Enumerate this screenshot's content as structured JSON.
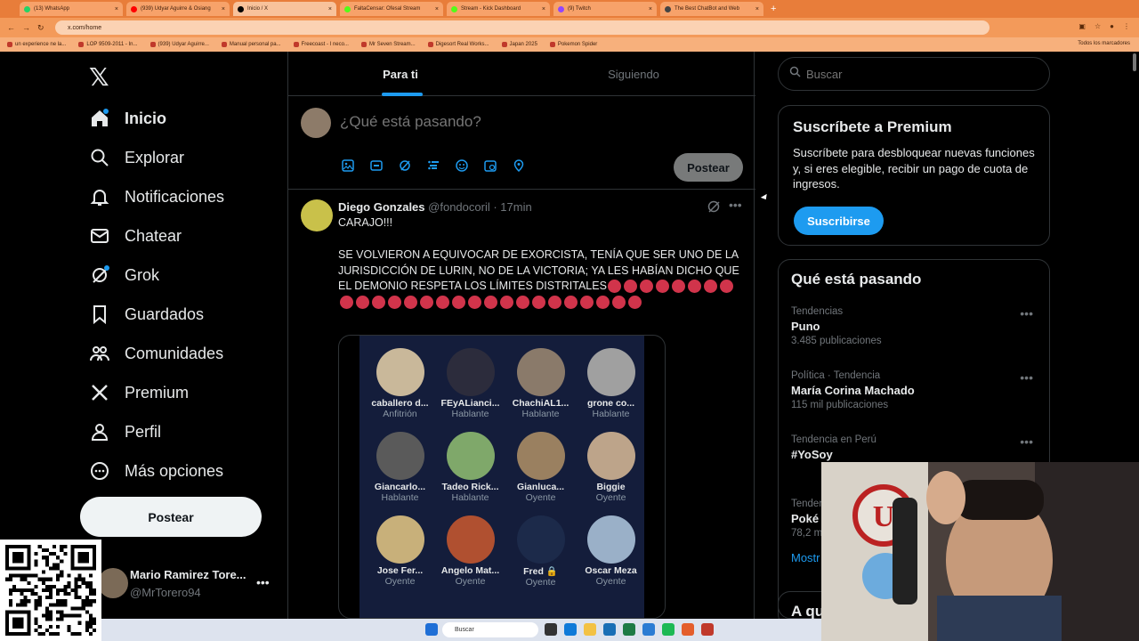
{
  "browser": {
    "tabs": [
      {
        "label": "(13) WhatsApp",
        "color": "#25d366"
      },
      {
        "label": "(939) Udyar Aguirre & Osiang",
        "color": "#ff0000"
      },
      {
        "label": "Inicio / X",
        "color": "#000000"
      },
      {
        "label": "FaltaCensar: Ofesal Stream",
        "color": "#53fc18"
      },
      {
        "label": "Stream - Kick Dashboard",
        "color": "#53fc18"
      },
      {
        "label": "(9) Twitch",
        "color": "#9146ff"
      },
      {
        "label": "The Best ChatBot and Web",
        "color": "#444444"
      }
    ],
    "url": "x.com/home",
    "bookmarks": [
      "un experience ne la...",
      "LOP 9509-2011 - In...",
      "(939) Udyar Aguirre...",
      "Manual personal pa...",
      "Freecoast - I neco...",
      "Mr Seven Stream...",
      "Digesort Real Works...",
      "Japan 2025",
      "Pokemon Spider"
    ],
    "bookmarks_right": "Todos los marcadores"
  },
  "sidebar": {
    "logo": "X",
    "items": [
      {
        "label": "Inicio",
        "icon": "home-icon"
      },
      {
        "label": "Explorar",
        "icon": "search-icon"
      },
      {
        "label": "Notificaciones",
        "icon": "bell-icon"
      },
      {
        "label": "Chatear",
        "icon": "mail-icon"
      },
      {
        "label": "Grok",
        "icon": "grok-icon"
      },
      {
        "label": "Guardados",
        "icon": "bookmark-icon"
      },
      {
        "label": "Comunidades",
        "icon": "communities-icon"
      },
      {
        "label": "Premium",
        "icon": "x-icon"
      },
      {
        "label": "Perfil",
        "icon": "person-icon"
      },
      {
        "label": "Más opciones",
        "icon": "more-circle-icon"
      }
    ],
    "post_label": "Postear",
    "profile": {
      "name": "Mario Ramirez Tore...",
      "handle": "@MrTorero94"
    }
  },
  "main": {
    "tabs": [
      {
        "label": "Para ti"
      },
      {
        "label": "Siguiendo"
      }
    ],
    "compose": {
      "placeholder": "¿Qué está pasando?",
      "post_label": "Postear"
    },
    "tweet": {
      "name": "Diego Gonzales",
      "handle": "@fondocoril",
      "time": "· 17min",
      "line1": "CARAJO!!!",
      "body": "SE VOLVIERON A EQUIVOCAR DE EXORCISTA, TENÍA QUE SER UNO DE LA JURISDICCIÓN DE LURIN, NO DE LA VICTORIA; YA LES HABÍAN DICHO QUE EL DEMONIO RESPETA LOS LÍMITES DISTRITALES",
      "space_participants": [
        {
          "name": "caballero d...",
          "role": "Anfitrión"
        },
        {
          "name": "FEyALianci...",
          "role": "Hablante"
        },
        {
          "name": "ChachiAL1...",
          "role": "Hablante"
        },
        {
          "name": "grone co...",
          "role": "Hablante"
        },
        {
          "name": "Giancarlo...",
          "role": "Hablante"
        },
        {
          "name": "Tadeo Rick...",
          "role": "Hablante"
        },
        {
          "name": "Gianluca...",
          "role": "Oyente"
        },
        {
          "name": "Biggie",
          "role": "Oyente"
        },
        {
          "name": "Jose Fer...",
          "role": "Oyente"
        },
        {
          "name": "Angelo Mat...",
          "role": "Oyente"
        },
        {
          "name": "Fred 🔒",
          "role": "Oyente"
        },
        {
          "name": "Oscar Meza",
          "role": "Oyente"
        }
      ]
    }
  },
  "right": {
    "search_placeholder": "Buscar",
    "premium": {
      "title": "Suscríbete a Premium",
      "text": "Suscríbete para desbloquear nuevas funciones y, si eres elegible, recibir un pago de cuota de ingresos.",
      "button": "Suscribirse"
    },
    "trends_title": "Qué está pasando",
    "trends": [
      {
        "meta": "Tendencias",
        "title": "Puno",
        "count": "3.485 publicaciones"
      },
      {
        "meta": "Política · Tendencia",
        "title": "María Corina Machado",
        "count": "115 mil publicaciones"
      },
      {
        "meta": "Tendencia en Perú",
        "title": "#YoSoy",
        "count": ""
      },
      {
        "meta": "Tender",
        "title": "Poké",
        "count": "78,2 m"
      }
    ],
    "show_more": "Mostr",
    "next_section": "A qu"
  },
  "taskbar": {
    "search": "Buscar"
  }
}
